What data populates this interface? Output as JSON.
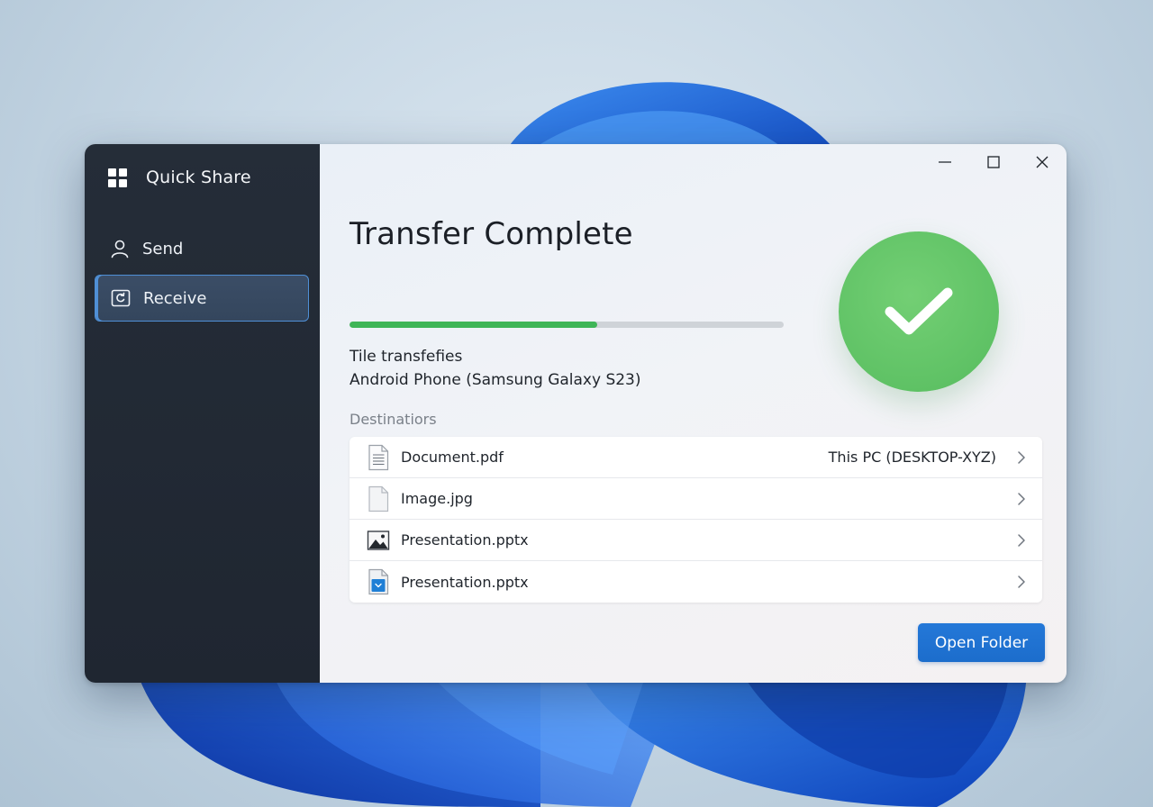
{
  "app": {
    "title": "Quick Share",
    "logo_icon": "windows-logo-icon"
  },
  "window_controls": {
    "minimize_icon": "minimize-icon",
    "maximize_icon": "maximize-icon",
    "close_icon": "close-icon"
  },
  "sidebar": {
    "items": [
      {
        "label": "Send",
        "icon": "person-icon",
        "selected": false
      },
      {
        "label": "Receive",
        "icon": "receive-icon",
        "selected": true
      }
    ]
  },
  "main": {
    "title": "Transfer Complete",
    "progress": 0.57,
    "transfer_label": "Tile transfefies",
    "device": "Android Phone (Samsung Galaxy S23)",
    "status_icon": "checkmark-icon",
    "destinations_label": "Destinatiors",
    "files": [
      {
        "name": "Document.pdf",
        "destination": "This PC (DESKTOP-XYZ)",
        "icon": "document-icon"
      },
      {
        "name": "Image.jpg",
        "destination": "",
        "icon": "blank-file-icon"
      },
      {
        "name": "Presentation.pptx",
        "destination": "",
        "icon": "image-file-icon"
      },
      {
        "name": "Presentation.pptx",
        "destination": "",
        "icon": "download-file-icon"
      }
    ],
    "open_folder_label": "Open Folder"
  },
  "colors": {
    "accent": "#1c6dcc",
    "success": "#5fc265",
    "progress": "#3fb557",
    "sidebar_bg": "#222a35",
    "selected_border": "#4f8fd6"
  }
}
